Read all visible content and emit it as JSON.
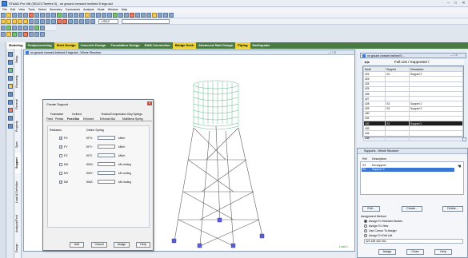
{
  "window": {
    "title": "STAAD.Pro V8i (SELECTseries 5) - on ground crossed inclined 5 legs.std",
    "min": "–",
    "max": "□",
    "close": "✕"
  },
  "menu": [
    "File",
    "Edit",
    "View",
    "Tools",
    "Select",
    "Geometry",
    "Commands",
    "Analysis",
    "Mode",
    "Window",
    "Help"
  ],
  "toolbar": {
    "load_select": "1:SELF",
    "group_select": ""
  },
  "mode_tabs": [
    {
      "label": "Modeling",
      "state": "active"
    },
    {
      "label": "Postprocessing",
      "state": "normal"
    },
    {
      "label": "Steel Design",
      "state": "hl"
    },
    {
      "label": "Concrete Design",
      "state": "normal"
    },
    {
      "label": "Foundation Design",
      "state": "normal"
    },
    {
      "label": "RAM Connection",
      "state": "normal"
    },
    {
      "label": "Bridge Deck",
      "state": "hl"
    },
    {
      "label": "Advanced Slab Design",
      "state": "normal"
    },
    {
      "label": "Piping",
      "state": "hl"
    },
    {
      "label": "Earthquake",
      "state": "normal"
    }
  ],
  "page_control": [
    "Setup",
    "Geometry",
    "General",
    "Property",
    "Spec",
    "Support",
    "Load & Definition",
    "Analysis/Print",
    "Design"
  ],
  "viewport": {
    "title": "on ground crossed inclined 5 legs.std - Whole Structure",
    "load_label": "Load 1"
  },
  "dialog": {
    "title": "Create Support",
    "tabs_row1": [
      "Foundation",
      "Inclined",
      "Tension/Compression Only Springs"
    ],
    "tabs_row2": [
      "Fixed",
      "Pinned",
      "Fixed But",
      "Enforced",
      "Enforced But",
      "Multilinear Spring"
    ],
    "releases_label": "Releases",
    "spring_label": "Define Spring",
    "rows": [
      {
        "release": "FX",
        "checked": true,
        "spring": "KFX:",
        "unit": "kN/m"
      },
      {
        "release": "FY",
        "checked": true,
        "spring": "KFY:",
        "unit": "kN/m"
      },
      {
        "release": "FZ",
        "checked": false,
        "spring": "KFZ:",
        "unit": "kN/m"
      },
      {
        "release": "MX",
        "checked": false,
        "spring": "KMX:",
        "unit": "kN-m/deg"
      },
      {
        "release": "MY",
        "checked": false,
        "spring": "KMY:",
        "unit": "kN-m/deg"
      },
      {
        "release": "MZ",
        "checked": true,
        "spring": "KMZ:",
        "unit": "kN-m/deg"
      }
    ],
    "buttons": [
      "Add",
      "Cancel",
      "Assign",
      "Help"
    ]
  },
  "node_table": {
    "window_title": "on ground crossed inclined 5 ...",
    "tab_label": "Full List / Supported /",
    "headers": [
      "Node",
      "Support",
      "Description"
    ],
    "rows": [
      [
        "422",
        "S2",
        "Support 2"
      ],
      [
        "423",
        "",
        ""
      ],
      [
        "424",
        "",
        ""
      ],
      [
        "425",
        "",
        ""
      ],
      [
        "426",
        "",
        ""
      ],
      [
        "427",
        "",
        ""
      ],
      [
        "428",
        "S2",
        "Support 2"
      ],
      [
        "429",
        "S2",
        "Support 2"
      ],
      [
        "430",
        "",
        ""
      ],
      [
        "431",
        "",
        ""
      ],
      [
        "432",
        "S2",
        "Support 2"
      ],
      [
        "433",
        "",
        ""
      ],
      [
        "434",
        "",
        ""
      ],
      [
        "435",
        "",
        ""
      ]
    ],
    "selected_row": 10
  },
  "supports_panel": {
    "title": "Supports - Whole Structure",
    "headers": [
      "Ref",
      "Description"
    ],
    "rows": [
      [
        "S1",
        "No support"
      ],
      [
        "S2",
        "Support 2"
      ]
    ],
    "buttons": [
      "Edit...",
      "Create...",
      "Delete..."
    ],
    "assign_method_label": "Assignment Method",
    "methods": [
      "Assign To Selected Nodes",
      "Assign To View",
      "Use Cursor To Assign",
      "Assign To Edit List"
    ],
    "selected_method": 0,
    "edit_list": "422 428 432 434",
    "bottom_buttons": [
      "Assign",
      "Close",
      "Help"
    ]
  }
}
